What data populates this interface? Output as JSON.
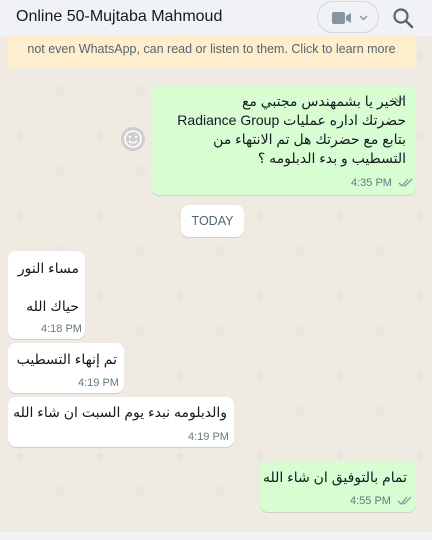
{
  "header": {
    "title": "Online 50-Mujtaba Mahmoud"
  },
  "banner": {
    "text": "not even WhatsApp, can read or listen to them. Click to learn more"
  },
  "messages": [
    {
      "direction": "out",
      "lines": [
        "الخير يا بشمهندس مجتبي مع",
        "حضرتك اداره عمليات Radiance Group",
        "بتابع مع حضرتك هل تم الانتهاء من",
        "التسطيب و بدء الدبلومه ؟"
      ],
      "time": "4:35 PM",
      "status": "read"
    },
    {
      "direction": "in",
      "lines": [
        "مساء النور",
        "",
        "حياك الله"
      ],
      "time": "4:18 PM"
    },
    {
      "direction": "in",
      "lines": [
        "تم إنهاء التسطيب"
      ],
      "time": "4:19 PM"
    },
    {
      "direction": "in",
      "lines": [
        "والدبلومه نبدء يوم السبت ان شاء الله"
      ],
      "time": "4:19 PM"
    },
    {
      "direction": "out",
      "lines": [
        "تمام بالتوفيق ان شاء الله"
      ],
      "time": "4:55 PM",
      "status": "read"
    }
  ],
  "date_separator": "TODAY",
  "colors": {
    "outgoing_bubble": "#d9fdd3",
    "incoming_bubble": "#ffffff",
    "read_ticks": "#8696a0",
    "banner": "#ffeecd"
  },
  "icons": {
    "video": "video-camera-icon",
    "search": "search-icon",
    "emoji": "emoji-icon",
    "ticks": "double-check-icon"
  }
}
